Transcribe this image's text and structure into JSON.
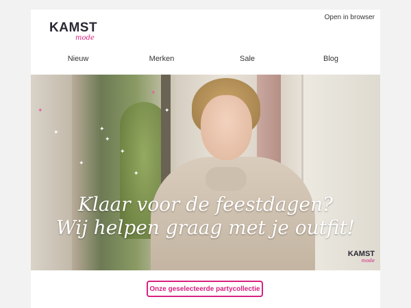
{
  "header": {
    "logo_text": "KAMST",
    "logo_script": "mode",
    "open_in_browser": "Open in browser"
  },
  "nav": {
    "items": [
      {
        "label": "Nieuw"
      },
      {
        "label": "Merken"
      },
      {
        "label": "Sale"
      },
      {
        "label": "Blog"
      }
    ]
  },
  "hero": {
    "line1": "Klaar voor de feestdagen?",
    "line2": "Wij helpen graag met je outfit!",
    "logo_text": "KAMST",
    "logo_script": "mode"
  },
  "cta": {
    "label": "Onze geselecteerde partycollectie"
  },
  "colors": {
    "accent": "#d6217f",
    "text": "#333333",
    "background": "#f2f2f2"
  }
}
